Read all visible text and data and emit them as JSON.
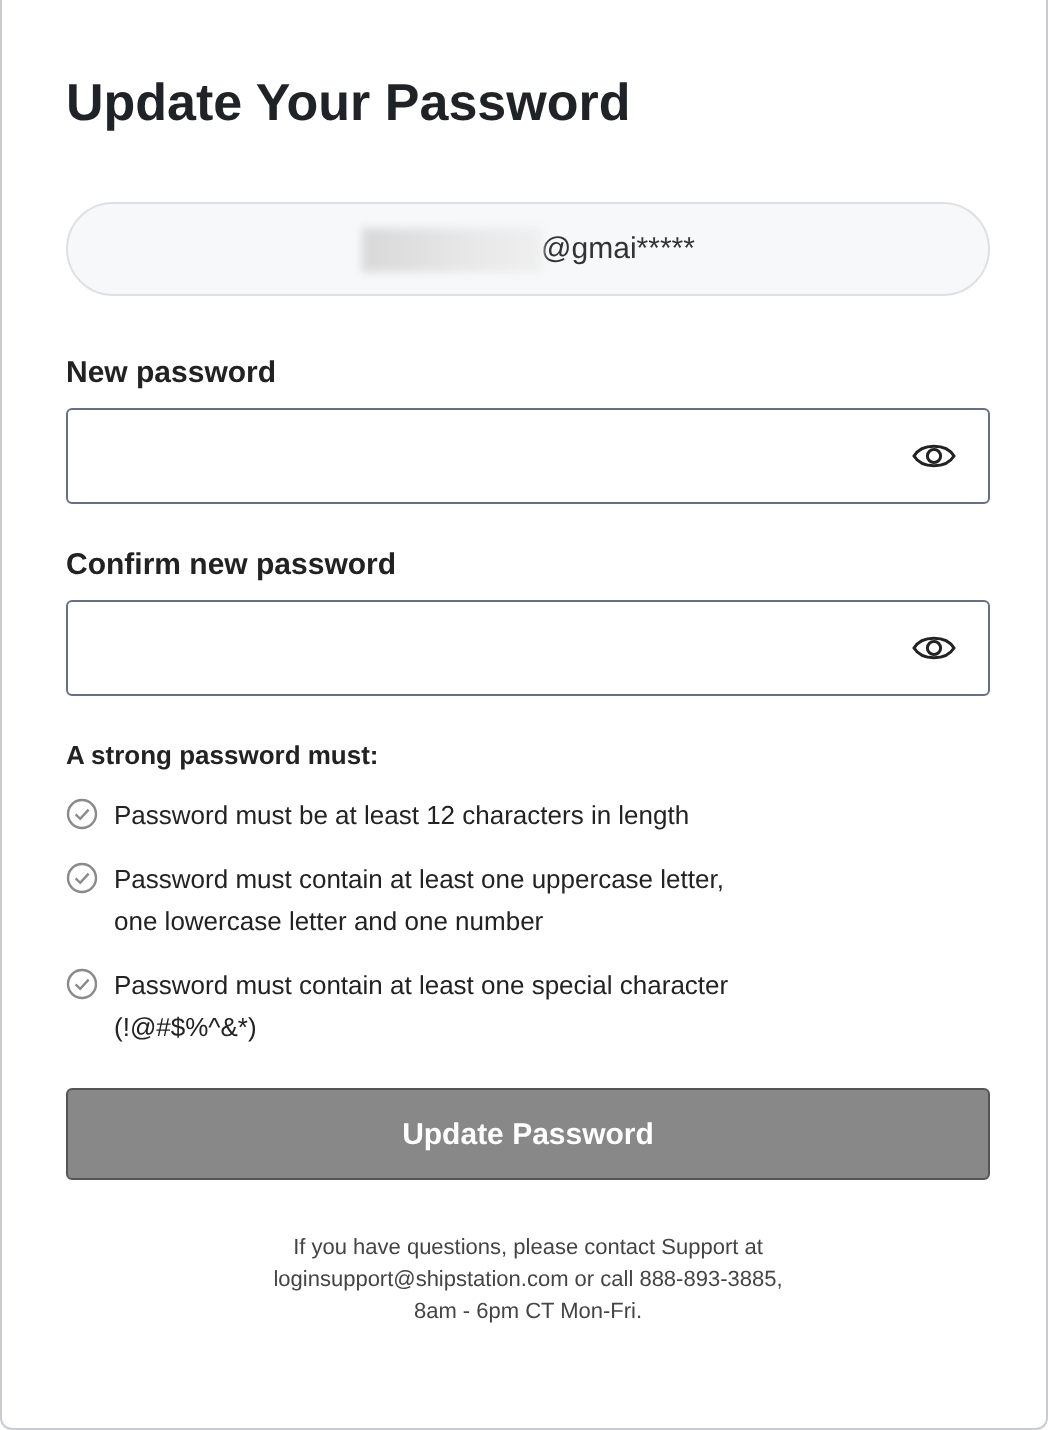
{
  "title": "Update Your Password",
  "account": {
    "email": "@gmai*****",
    "redacted": true
  },
  "fields": [
    {
      "label": "New password"
    },
    {
      "label": "Confirm new password"
    }
  ],
  "requirements": {
    "heading": "A strong password must:",
    "items": [
      {
        "lines": [
          "Password must be at least 12 characters in length"
        ],
        "met": false
      },
      {
        "lines": [
          "Password must contain at least one uppercase letter,",
          "one lowercase letter and one number"
        ],
        "met": false
      },
      {
        "lines": [
          "Password must contain at least one special character",
          "(!@#$%^&*)"
        ],
        "met": false
      }
    ]
  },
  "submit": {
    "label": "Update Password",
    "disabled": true
  },
  "footer": {
    "lines": [
      "If you have questions, please contact Support at",
      "loginsupport@shipstation.com or call 888-893-3885,",
      "8am - 6pm CT Mon-Fri."
    ]
  }
}
